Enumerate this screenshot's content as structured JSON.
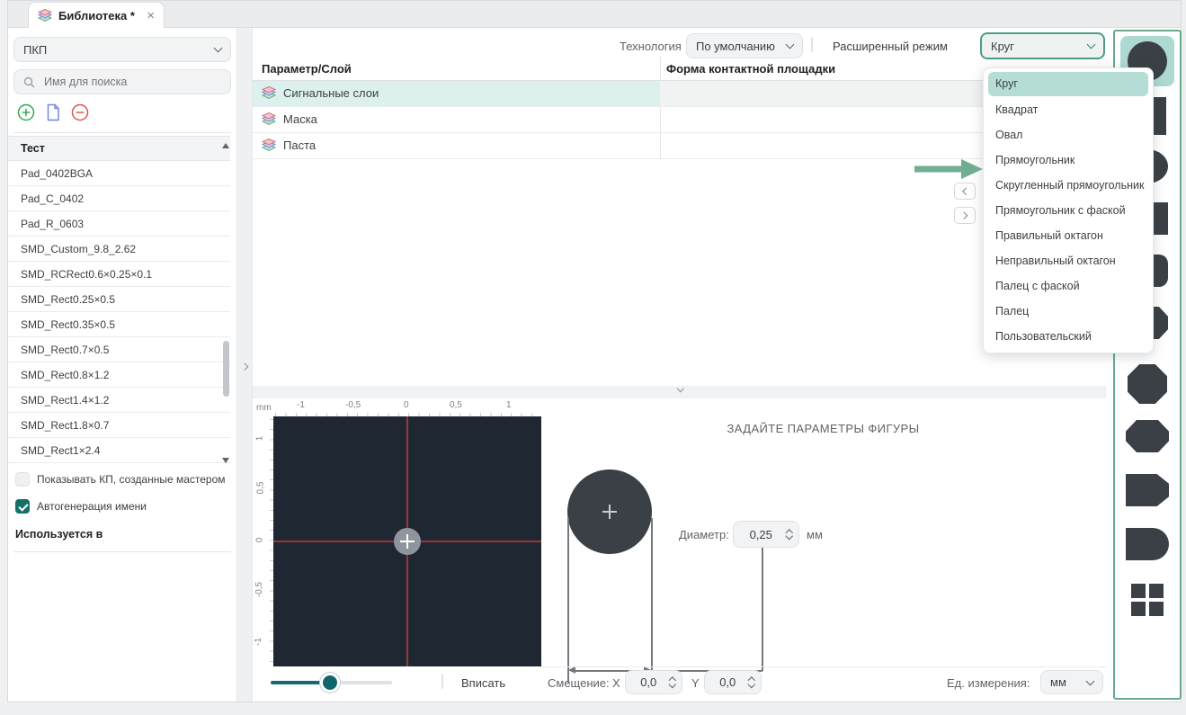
{
  "window": {
    "tab_title": "Библиотека *",
    "close_icon": "×"
  },
  "left_panel": {
    "category_select": {
      "value": "ПКП"
    },
    "search": {
      "placeholder": "Имя для поиска"
    },
    "list": {
      "header": "Тест",
      "items": [
        "Pad_0402BGA",
        "Pad_C_0402",
        "Pad_R_0603",
        "SMD_Custom_9.8_2.62",
        "SMD_RCRect0.6×0.25×0.1",
        "SMD_Rect0.25×0.5",
        "SMD_Rect0.35×0.5",
        "SMD_Rect0.7×0.5",
        "SMD_Rect0.8×1.2",
        "SMD_Rect1.4×1.2",
        "SMD_Rect1.8×0.7",
        "SMD_Rect1×2.4"
      ]
    },
    "show_master_checkbox": {
      "label": "Показывать КП, созданные мастером",
      "checked": false
    },
    "autogen_checkbox": {
      "label": "Автогенерация имени",
      "checked": true
    },
    "used_in_header": "Используется в"
  },
  "toolbar": {
    "technology_label": "Технология",
    "technology_select": {
      "value": "По умолчанию"
    },
    "extended_mode": {
      "label": "Расширенный режим",
      "checked": false
    },
    "shape_select": {
      "value": "Круг"
    }
  },
  "layers_table": {
    "columns": [
      "Параметр/Слой",
      "Форма контактной площадки"
    ],
    "rows": [
      {
        "name": "Сигнальные слои",
        "selected": true
      },
      {
        "name": "Маска",
        "selected": false
      },
      {
        "name": "Паста",
        "selected": false
      }
    ]
  },
  "shape_dropdown": {
    "selected_index": 0,
    "options": [
      "Круг",
      "Квадрат",
      "Овал",
      "Прямоугольник",
      "Скругленный прямоугольник",
      "Прямоугольник с фаской",
      "Правильный октагон",
      "Неправильный октагон",
      "Палец с фаской",
      "Палец",
      "Пользовательский"
    ]
  },
  "shape_palette": {
    "icons": [
      "circle",
      "square",
      "oval",
      "rectangle",
      "rounded-rectangle",
      "chamfered-rectangle",
      "regular-octagon",
      "irregular-octagon",
      "finger-chamfered",
      "finger",
      "custom"
    ],
    "selected": "circle"
  },
  "viewport": {
    "unit_label": "mm",
    "h_ticks": [
      "-1",
      "-0,5",
      "0",
      "0,5",
      "1"
    ],
    "v_ticks": [
      "1",
      "0,5",
      "0",
      "-0,5",
      "-1"
    ],
    "fit_checkbox": {
      "label": "Вписать",
      "checked": false
    }
  },
  "shape_params": {
    "title": "ЗАДАЙТЕ ПАРАМЕТРЫ ФИГУРЫ",
    "diameter": {
      "label": "Диаметр:",
      "value": "0,25",
      "unit": "мм"
    },
    "offset": {
      "label": "Смещение:",
      "x_label": "X",
      "x_value": "0,0",
      "y_label": "Y",
      "y_value": "0,0"
    },
    "units": {
      "label": "Ед. измерения:",
      "value": "мм"
    }
  },
  "colors": {
    "accent_teal": "#15706b",
    "dropdown_highlight": "#b5ddd6",
    "row_selection": "#dcf0ed",
    "sidebar_border": "#6aa98b",
    "arrow_green": "#6fae90",
    "canvas_bg": "#1f2733",
    "crosshair_red": "#9e3434",
    "shape_dark": "#3a4045"
  }
}
